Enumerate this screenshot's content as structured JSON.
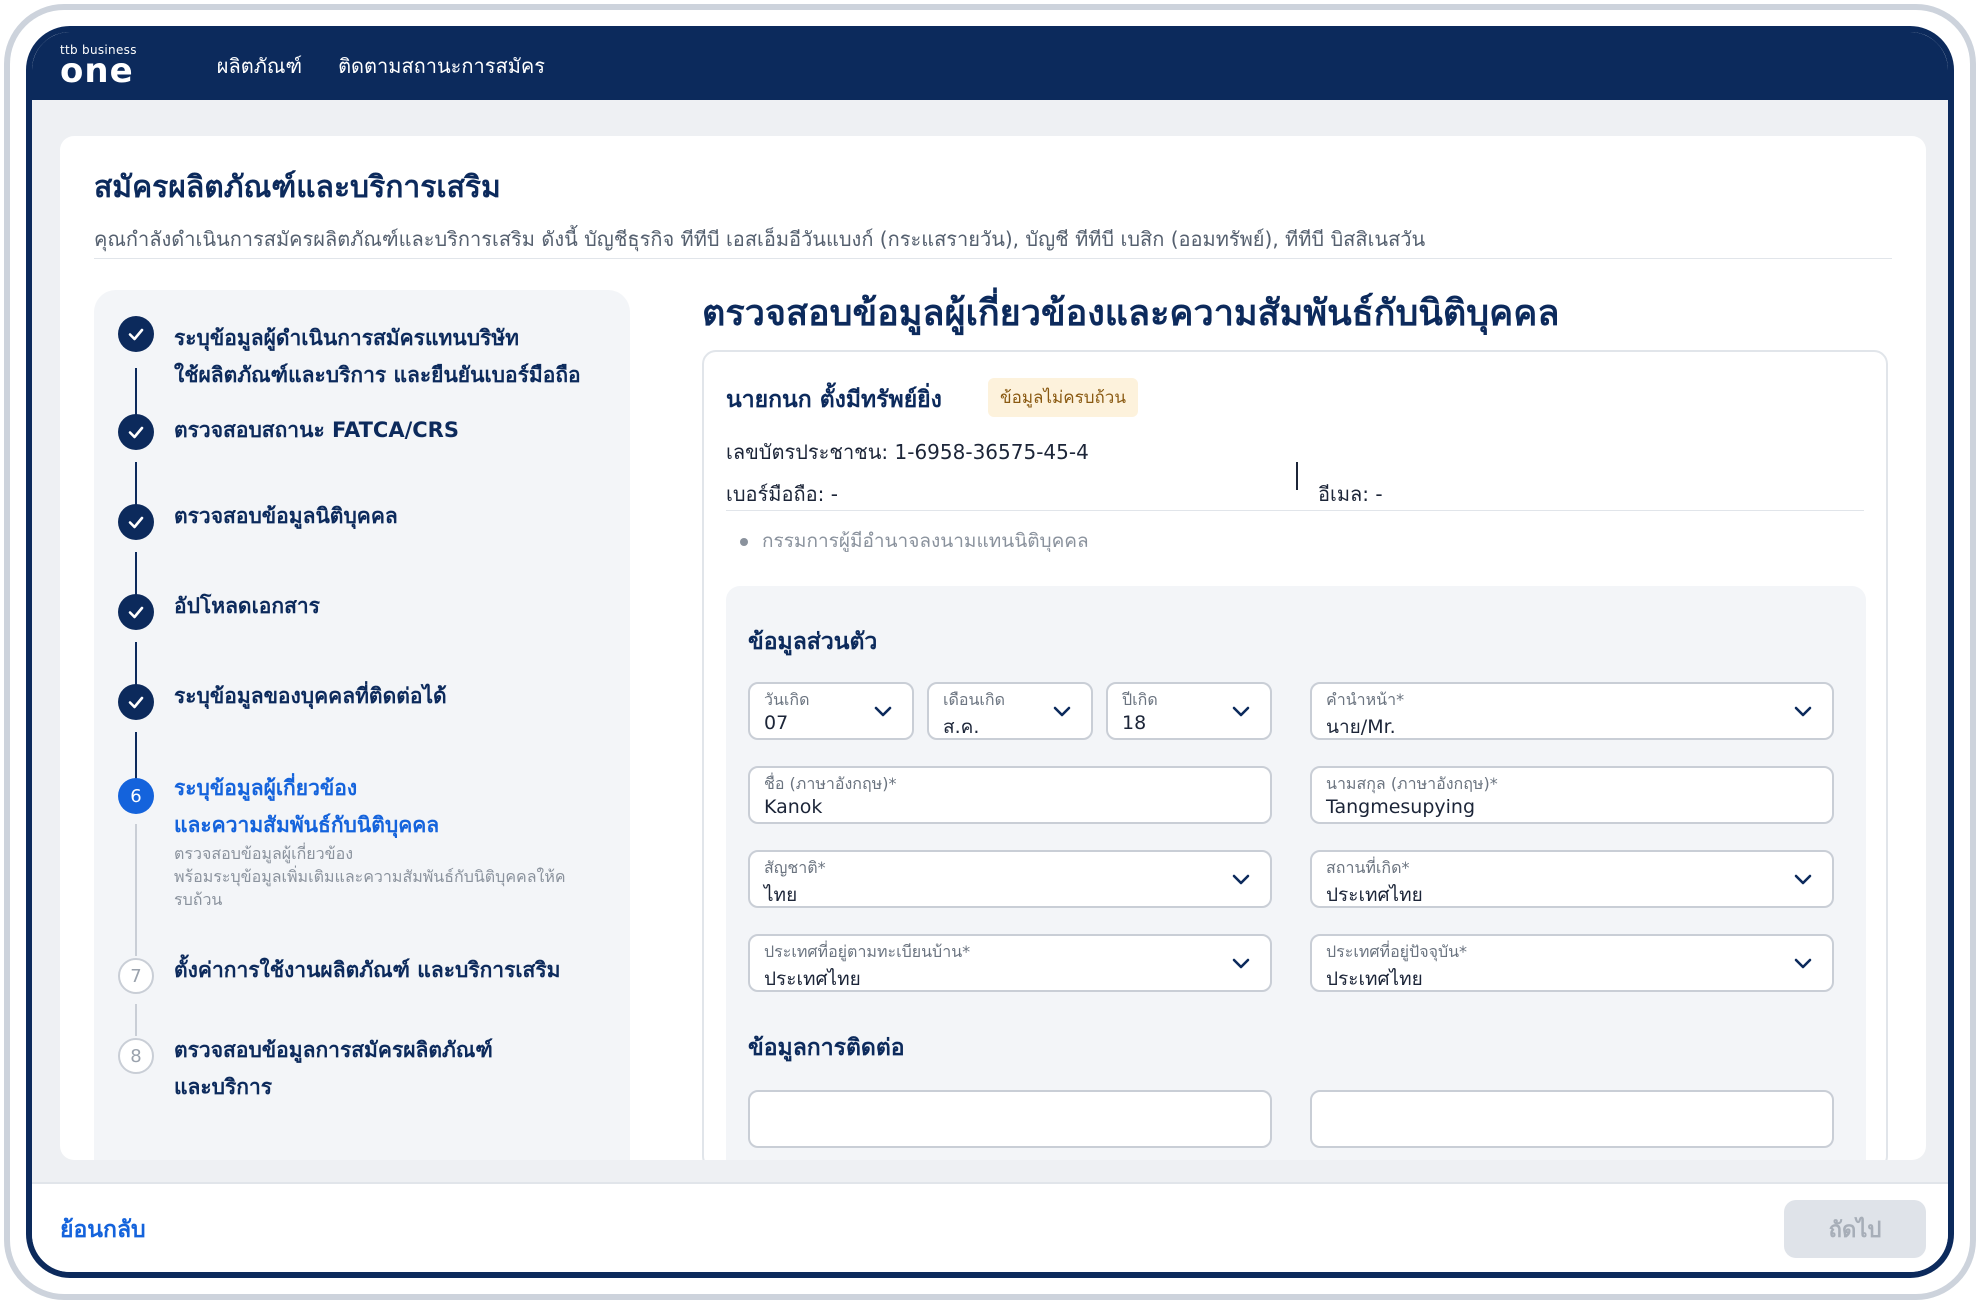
{
  "header": {
    "logo_small": "ttb business",
    "logo_big": "one",
    "nav": [
      "ผลิตภัณฑ์",
      "ติดตามสถานะการสมัคร"
    ]
  },
  "page": {
    "title": "สมัครผลิตภัณฑ์และบริการเสริม",
    "subtitle": "คุณกำลังดำเนินการสมัครผลิตภัณฑ์และบริการเสริม ดังนี้  บัญชีธุรกิจ ทีทีบี เอสเอ็มอีวันแบงก์ (กระแสรายวัน),  บัญชี ทีทีบี เบสิก (ออมทรัพย์),  ทีทีบี บิสสิเนสวัน"
  },
  "steps": [
    {
      "label_1": "ระบุข้อมูลผู้ดำเนินการสมัครแทนบริษัท",
      "label_2": "ใช้ผลิตภัณฑ์และบริการ และยืนยันเบอร์มือถือ",
      "status": "done"
    },
    {
      "label_1": "ตรวจสอบสถานะ FATCA/CRS",
      "status": "done"
    },
    {
      "label_1": "ตรวจสอบข้อมูลนิติบุคคล",
      "status": "done"
    },
    {
      "label_1": "อัปโหลดเอกสาร",
      "status": "done"
    },
    {
      "label_1": "ระบุข้อมูลของบุคคลที่ติดต่อได้",
      "status": "done"
    },
    {
      "number": "6",
      "label_1": "ระบุข้อมูลผู้เกี่ยวข้อง",
      "label_2": "และความสัมพันธ์กับนิติบุคคล",
      "desc_1": "ตรวจสอบข้อมูลผู้เกี่ยวข้อง",
      "desc_2": "พร้อมระบุข้อมูลเพิ่มเติมและความสัมพันธ์กับนิติบุคคลให้ค",
      "desc_3": "รบถ้วน",
      "status": "active"
    },
    {
      "number": "7",
      "label_1": "ตั้งค่าการใช้งานผลิตภัณฑ์ และบริการเสริม",
      "status": "todo"
    },
    {
      "number": "8",
      "label_1": "ตรวจสอบข้อมูลการสมัครผลิตภัณฑ์",
      "label_2": "และบริการ",
      "status": "todo"
    }
  ],
  "content": {
    "title": "ตรวจสอบข้อมูลผู้เกี่ยวข้องและความสัมพันธ์กับนิติบุคคล",
    "person": {
      "name": "นายกนก ตั้งมีทรัพย์ยิ่ง",
      "badge": "ข้อมูลไม่ครบถ้วน",
      "id_card": "เลขบัตรประชาชน: 1-6958-36575-45-4",
      "mobile": "เบอร์มือถือ: -",
      "email": "อีเมล: -",
      "role": "กรรมการผู้มีอำนาจลงนามแทนนิติบุคคล"
    },
    "personal_section_title": "ข้อมูลส่วนตัว",
    "contact_section_title": "ข้อมูลการติดต่อ",
    "fields": {
      "birth_day": {
        "label": "วันเกิด",
        "value": "07"
      },
      "birth_month": {
        "label": "เดือนเกิด",
        "value": "ส.ค."
      },
      "birth_year": {
        "label": "ปีเกิด",
        "value": "18"
      },
      "title": {
        "label": "คำนำหน้า*",
        "value": "นาย/Mr."
      },
      "first_name_en": {
        "label": "ชื่อ (ภาษาอังกฤษ)*",
        "value": "Kanok"
      },
      "last_name_en": {
        "label": "นามสกุล (ภาษาอังกฤษ)*",
        "value": "Tangmesupying"
      },
      "nationality": {
        "label": "สัญชาติ*",
        "value": "ไทย"
      },
      "birth_place": {
        "label": "สถานที่เกิด*",
        "value": "ประเทศไทย"
      },
      "registered_country": {
        "label": "ประเทศที่อยู่ตามทะเบียนบ้าน*",
        "value": "ประเทศไทย"
      },
      "current_country": {
        "label": "ประเทศที่อยู่ปัจจุบัน*",
        "value": "ประเทศไทย"
      }
    }
  },
  "footer": {
    "back_label": "ย้อนกลับ",
    "next_label": "ถัดไป"
  },
  "colors": {
    "navy": "#0c2a5c",
    "accent_blue": "#1463dc",
    "badge_bg": "#fdf2dc"
  }
}
